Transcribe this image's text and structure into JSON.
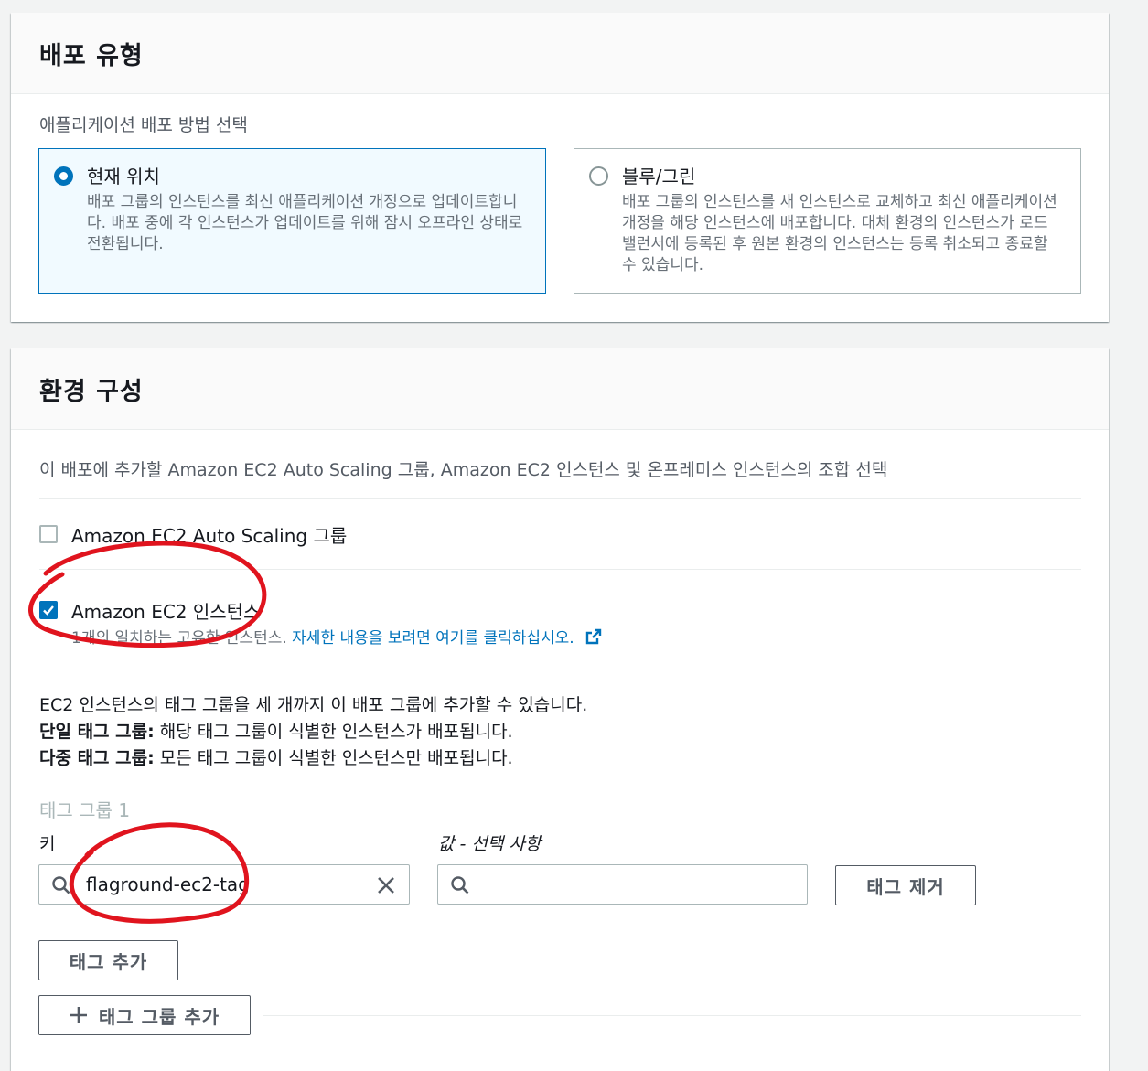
{
  "deployment_type": {
    "title": "배포 유형",
    "description": "애플리케이션 배포 방법 선택",
    "options": [
      {
        "label": "현재 위치",
        "description": "배포 그룹의 인스턴스를 최신 애플리케이션 개정으로 업데이트합니다. 배포 중에 각 인스턴스가 업데이트를 위해 잠시 오프라인 상태로 전환됩니다.",
        "selected": true
      },
      {
        "label": "블루/그린",
        "description": "배포 그룹의 인스턴스를 새 인스턴스로 교체하고 최신 애플리케이션 개정을 해당 인스턴스에 배포합니다. 대체 환경의 인스턴스가 로드 밸런서에 등록된 후 원본 환경의 인스턴스는 등록 취소되고 종료할 수 있습니다.",
        "selected": false
      }
    ]
  },
  "environment": {
    "title": "환경 구성",
    "description": "이 배포에 추가할 Amazon EC2 Auto Scaling 그룹, Amazon EC2 인스턴스 및 온프레미스 인스턴스의 조합 선택",
    "asg_checkbox": {
      "label": "Amazon EC2 Auto Scaling 그룹",
      "checked": false
    },
    "ec2_checkbox": {
      "label": "Amazon EC2 인스턴스",
      "checked": true,
      "sub_text": "1개의 일치하는 고유한 인스턴스.",
      "link_text": "자세한 내용을 보려면 여기를 클릭하십시오."
    },
    "info_line1": "EC2 인스턴스의 태그 그룹을 세 개까지 이 배포 그룹에 추가할 수 있습니다.",
    "single_label": "단일 태그 그룹:",
    "single_text": " 해당 태그 그룹이 식별한 인스턴스가 배포됩니다.",
    "multi_label": "다중 태그 그룹:",
    "multi_text": " 모든 태그 그룹이 식별한 인스턴스만 배포됩니다.",
    "tag_group_title": "태그 그룹 1",
    "key_label": "키",
    "value_label": "값 - 선택 사항",
    "key_value": "flaground-ec2-tag",
    "value_value": "",
    "remove_tag_button": "태그 제거",
    "add_tag_button": "태그 추가",
    "add_tag_group_button": "태그 그룹 추가"
  },
  "colors": {
    "primary_blue": "#0073bb",
    "annotation_red": "#e0141e",
    "selected_tile_bg": "#f1faff"
  }
}
